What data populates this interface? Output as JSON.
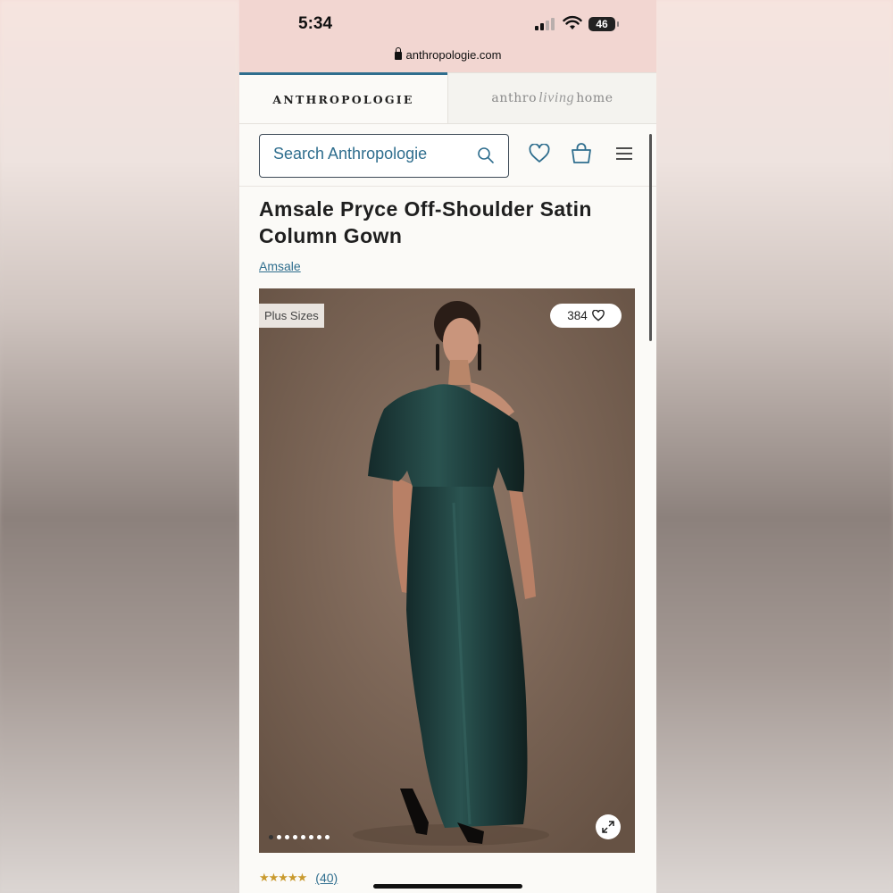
{
  "status_bar": {
    "time": "5:34",
    "battery": "46",
    "url": "anthropologie.com"
  },
  "brand_tabs": {
    "active": "ANTHROPOLOGIE",
    "other_left": "anthro",
    "other_script": "living",
    "other_right": "home"
  },
  "search": {
    "placeholder": "Search Anthropologie"
  },
  "product": {
    "title": "Amsale Pryce Off-Shoulder Satin Column Gown",
    "brand": "Amsale",
    "badge": "Plus Sizes",
    "likes": "384",
    "image_count": 8,
    "active_image_index": 0,
    "rating_value": 4.5,
    "rating_stars": "★★★★★",
    "review_count": "(40)"
  },
  "colors": {
    "accent": "#2f6e8e",
    "dress": "#1f3d3c",
    "backdrop": "#7a6556",
    "status_bg": "#f2d6d1"
  }
}
